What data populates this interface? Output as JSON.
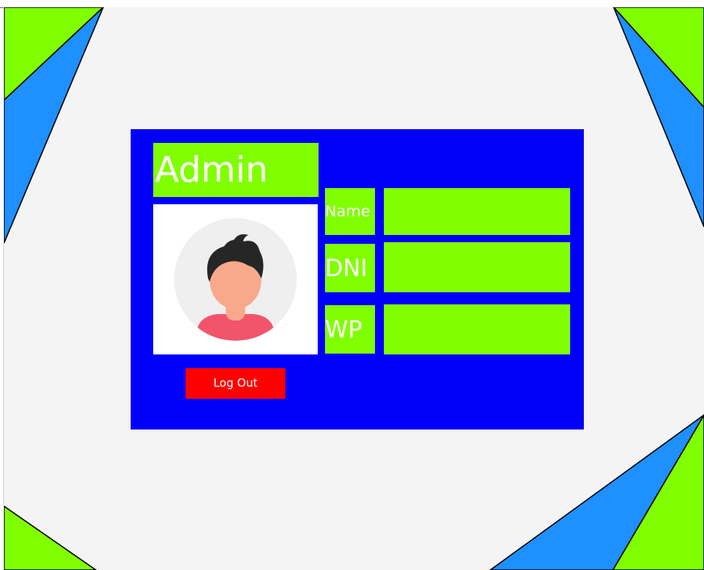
{
  "profile": {
    "role": "Admin",
    "logout_label": "Log Out",
    "fields": {
      "name": {
        "label": "Name",
        "value": ""
      },
      "dni": {
        "label": "DNI",
        "value": ""
      },
      "wp": {
        "label": "WP",
        "value": ""
      }
    }
  },
  "colors": {
    "background": "#f4f4f4",
    "card": "#0000fa",
    "accent_green": "#80ff00",
    "accent_blue": "#1e90ff",
    "logout": "#ff0000",
    "text_light": "#ffffff"
  },
  "icons": {
    "avatar": "user-avatar-icon"
  }
}
